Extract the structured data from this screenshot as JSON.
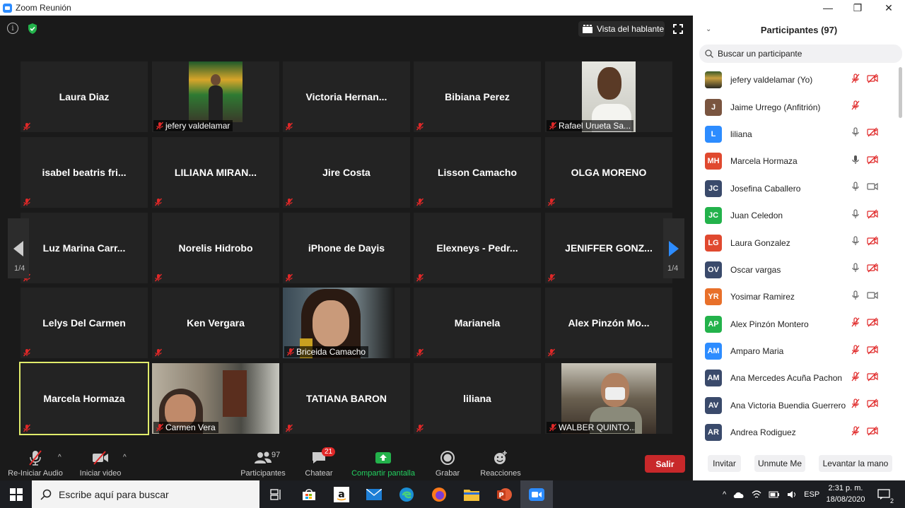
{
  "window": {
    "title": "Zoom Reunión",
    "minimize": "—",
    "maximize": "❐",
    "close": "✕"
  },
  "meeting": {
    "view_button": "Vista del hablante",
    "page_left": "1/4",
    "page_right": "1/4",
    "tiles": [
      {
        "name": "Laura Diaz",
        "label": ""
      },
      {
        "name": "",
        "label": "jefery valdelamar"
      },
      {
        "name": "Victoria  Hernan...",
        "label": ""
      },
      {
        "name": "Bibiana Perez",
        "label": ""
      },
      {
        "name": "",
        "label": "Rafael Urueta Sa..."
      },
      {
        "name": "isabel  beatris  fri...",
        "label": ""
      },
      {
        "name": "LILIANA  MIRAN...",
        "label": ""
      },
      {
        "name": "Jire Costa",
        "label": ""
      },
      {
        "name": "Lisson Camacho",
        "label": ""
      },
      {
        "name": "OLGA MORENO",
        "label": ""
      },
      {
        "name": "Luz  Marina  Carr...",
        "label": ""
      },
      {
        "name": "Norelis Hidrobo",
        "label": ""
      },
      {
        "name": "iPhone de Dayis",
        "label": ""
      },
      {
        "name": "Elexneys  -  Pedr...",
        "label": ""
      },
      {
        "name": "JENIFFER  GONZ...",
        "label": ""
      },
      {
        "name": "Lelys Del Carmen",
        "label": ""
      },
      {
        "name": "Ken Vergara",
        "label": ""
      },
      {
        "name": "",
        "label": "Briceida Camacho"
      },
      {
        "name": "Marianela",
        "label": ""
      },
      {
        "name": "Alex  Pinzón  Mo...",
        "label": ""
      },
      {
        "name": "Marcela Hormaza",
        "label": ""
      },
      {
        "name": "",
        "label": "Carmen Vera"
      },
      {
        "name": "TATIANA BARON",
        "label": ""
      },
      {
        "name": "liliana",
        "label": ""
      },
      {
        "name": "",
        "label": "WALBER QUINTO..."
      }
    ]
  },
  "toolbar": {
    "audio": "Re-Iniciar Audio",
    "video": "Iniciar video",
    "participants": "Participantes",
    "participants_count": "97",
    "chat": "Chatear",
    "chat_badge": "21",
    "share": "Compartir pantalla",
    "record": "Grabar",
    "reactions": "Reacciones",
    "leave": "Salir"
  },
  "panel": {
    "title": "Participantes (97)",
    "search_placeholder": "Buscar un participante",
    "participants": [
      {
        "initials": "",
        "name": "jefery valdelamar (Yo)",
        "color": "#6b7a55",
        "mic": "muted",
        "cam": "off"
      },
      {
        "initials": "J",
        "name": "Jaime Urrego (Anfitrión)",
        "color": "#7a5540",
        "mic": "muted",
        "cam": "none"
      },
      {
        "initials": "L",
        "name": "liliana",
        "color": "#2d8cff",
        "mic": "on",
        "cam": "off"
      },
      {
        "initials": "MH",
        "name": "Marcela Hormaza",
        "color": "#e0492f",
        "mic": "on-dark",
        "cam": "off"
      },
      {
        "initials": "JC",
        "name": "Josefina Caballero",
        "color": "#3a4a6b",
        "mic": "on",
        "cam": "on"
      },
      {
        "initials": "JC",
        "name": "Juan Celedon",
        "color": "#23b24b",
        "mic": "on",
        "cam": "off"
      },
      {
        "initials": "LG",
        "name": "Laura Gonzalez",
        "color": "#e0492f",
        "mic": "on",
        "cam": "off"
      },
      {
        "initials": "OV",
        "name": "Oscar vargas",
        "color": "#3a4a6b",
        "mic": "on",
        "cam": "off"
      },
      {
        "initials": "YR",
        "name": "Yosimar Ramirez",
        "color": "#e8702a",
        "mic": "on",
        "cam": "on"
      },
      {
        "initials": "AP",
        "name": "Alex Pinzón Montero",
        "color": "#23b24b",
        "mic": "muted",
        "cam": "off"
      },
      {
        "initials": "AM",
        "name": "Amparo Maria",
        "color": "#2d8cff",
        "mic": "muted",
        "cam": "off"
      },
      {
        "initials": "AM",
        "name": "Ana Mercedes Acuña Pachon",
        "color": "#3a4a6b",
        "mic": "muted",
        "cam": "off"
      },
      {
        "initials": "AV",
        "name": "Ana Victoria Buendia Guerrero",
        "color": "#3a4a6b",
        "mic": "muted",
        "cam": "off"
      },
      {
        "initials": "AR",
        "name": "Andrea Rodiguez",
        "color": "#3a4a6b",
        "mic": "muted",
        "cam": "off"
      }
    ],
    "invite": "Invitar",
    "unmute": "Unmute Me",
    "raise_hand": "Levantar la mano"
  },
  "taskbar": {
    "search_placeholder": "Escribe aquí para buscar",
    "lang": "ESP",
    "time": "2:31 p. m.",
    "date": "18/08/2020",
    "notifications": "2"
  }
}
